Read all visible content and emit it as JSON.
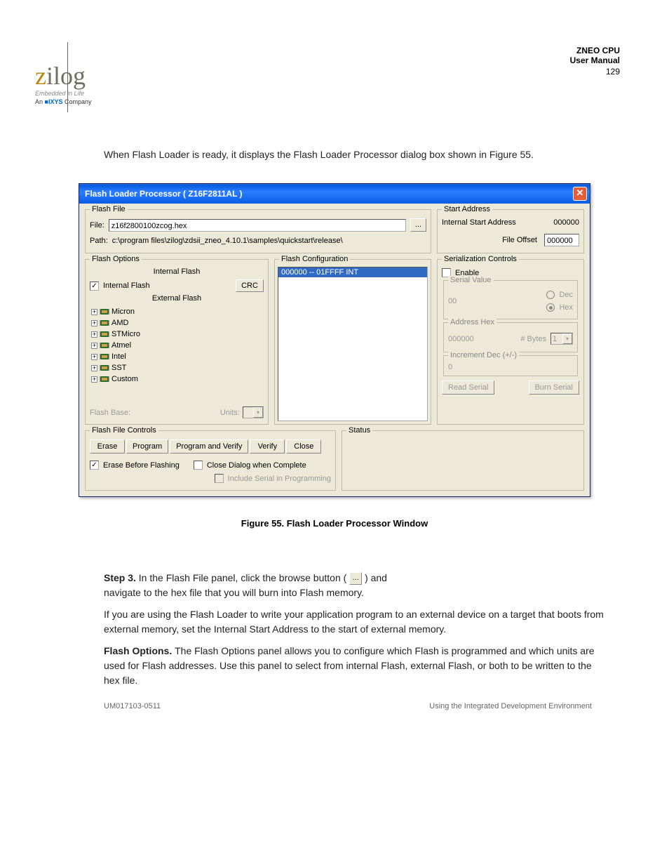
{
  "header": {
    "code": "ZNEO CPU",
    "title": "User Manual"
  },
  "logo": {
    "text": "zilog",
    "sub1": "Embedded in Life",
    "sub2_prefix": "An ",
    "sub2_brand": "■IXYS",
    "sub2_suffix": " Company"
  },
  "intro": [
    "When Flash Loader is ready, it displays the Flash Loader Processor dialog box shown in Figure 55."
  ],
  "window": {
    "title": "Flash Loader Processor ( Z16F2811AL )",
    "group_flash_file": "Flash File",
    "file_label": "File:",
    "file_value": "z16f2800100zcog.hex",
    "path_label": "Path:",
    "path_value": "c:\\program files\\zilog\\zdsii_zneo_4.10.1\\samples\\quickstart\\release\\",
    "browse": "...",
    "group_start_addr": "Start Address",
    "isa_label": "Internal Start Address",
    "isa_value": "000000",
    "offset_label": "File Offset",
    "offset_value": "000000",
    "group_flash_options": "Flash Options",
    "internal_header": "Internal Flash",
    "internal_flash_cb": "Internal Flash",
    "crc_btn": "CRC",
    "external_header": "External Flash",
    "tree": [
      "Micron",
      "AMD",
      "STMicro",
      "Atmel",
      "Intel",
      "SST",
      "Custom"
    ],
    "flash_base": "Flash Base:",
    "units": "Units:",
    "group_flash_config": "Flash Configuration",
    "config_item": "000000 -- 01FFFF INT",
    "group_serial": "Serialization Controls",
    "enable": "Enable",
    "serial_value": "Serial Value",
    "serial_value_val": "00",
    "dec": "Dec",
    "hex": "Hex",
    "addr_hex": "Address Hex",
    "addr_hex_val": "000000",
    "bytes_label": "# Bytes",
    "bytes_val": "1",
    "incr": "Increment Dec (+/-)",
    "incr_val": "0",
    "read_serial": "Read Serial",
    "burn_serial": "Burn Serial",
    "group_ffc": "Flash File Controls",
    "erase": "Erase",
    "program": "Program",
    "program_verify": "Program and Verify",
    "verify": "Verify",
    "close": "Close",
    "erase_before": "Erase Before Flashing",
    "close_complete": "Close Dialog when Complete",
    "include_serial": "Include Serial in Programming",
    "group_status": "Status"
  },
  "caption": "Figure 55. Flash Loader Processor Window",
  "after": {
    "step_label": "Step 3.",
    "step_text": "In the Flash File panel, click the browse button (",
    "step_text_after": ") and",
    "step_cont": "navigate to the hex file that you will burn into Flash memory.",
    "para1": "If you are using the Flash Loader to write your application program to an external device on a target that boots from external memory, set the Internal Start Address to the start of external memory.",
    "para2_head": "Flash Options. ",
    "para2": "The Flash Options panel allows you to configure which Flash is programmed and which units are used for Flash addresses. Use this panel to select from internal Flash, external Flash, or both to be written to the hex file."
  },
  "footer": {
    "code": "UM017103-0511",
    "section": "Using the Integrated Development Environment"
  },
  "page_number": "129"
}
